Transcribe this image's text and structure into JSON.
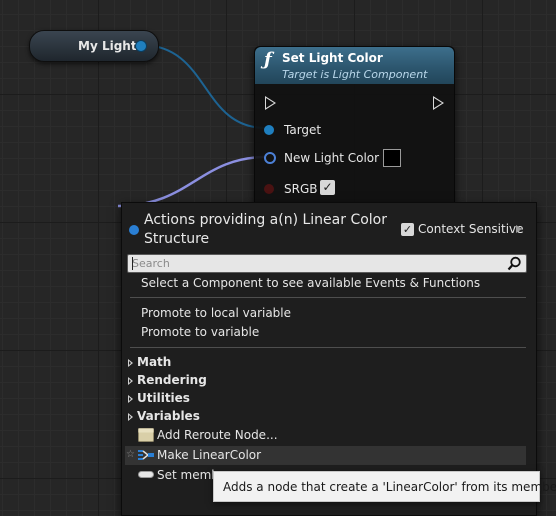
{
  "variable_node": {
    "label": "My Light"
  },
  "function_node": {
    "title": "Set Light Color",
    "subtitle": "Target is Light Component",
    "pins": [
      {
        "label": "Target"
      },
      {
        "label": "New Light Color"
      },
      {
        "label": "SRGB"
      }
    ]
  },
  "action_menu": {
    "title": "Actions providing a(n) Linear Color Structure",
    "context_sensitive_label": "Context Sensitive",
    "search_placeholder": "Search",
    "hint": "Select a Component to see available Events & Functions",
    "promote_local": "Promote to local variable",
    "promote_var": "Promote to variable",
    "categories": [
      "Math",
      "Rendering",
      "Utilities",
      "Variables"
    ],
    "actions": [
      {
        "label": "Add Reroute Node...",
        "icon": "reroute-node-icon"
      },
      {
        "label": "Make LinearColor",
        "icon": "make-struct-icon"
      },
      {
        "label": "Set memb",
        "icon": "set-members-icon"
      }
    ]
  },
  "tooltip": {
    "text": "Adds a node that create a 'LinearColor' from its members"
  },
  "colors": {
    "object_pin": "#1f7fbf",
    "struct_wire": "#7f84d9",
    "header": "#2b546c",
    "accent": "#2a7fd4"
  }
}
